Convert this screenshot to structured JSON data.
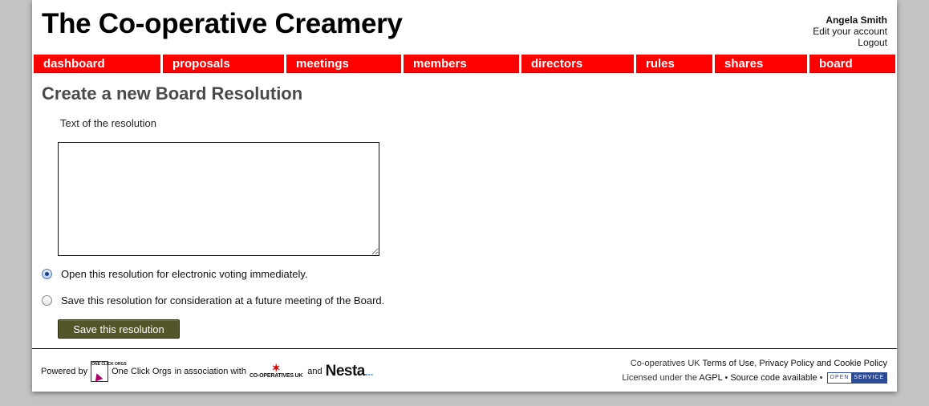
{
  "site": {
    "title": "The Co-operative Creamery"
  },
  "account": {
    "user_name": "Angela Smith",
    "edit_link": "Edit your account",
    "logout_link": "Logout"
  },
  "nav": {
    "items": [
      {
        "label": "dashboard"
      },
      {
        "label": "proposals"
      },
      {
        "label": "meetings"
      },
      {
        "label": "members"
      },
      {
        "label": "directors"
      },
      {
        "label": "rules"
      },
      {
        "label": "shares"
      },
      {
        "label": "board"
      }
    ]
  },
  "main": {
    "heading": "Create a new Board Resolution",
    "text_label": "Text of the resolution",
    "text_value": "",
    "options": [
      {
        "label": "Open this resolution for electronic voting immediately.",
        "checked": true
      },
      {
        "label": "Save this resolution for consideration at a future meeting of the Board.",
        "checked": false
      }
    ],
    "save_button": "Save this resolution"
  },
  "footer": {
    "powered_by": "Powered by",
    "oco_logo_text": "ONE CLICK ORGS",
    "oco_name": "One Click Orgs",
    "in_association": "in association with",
    "coops_logo_text": "CO-OPERATIVES UK",
    "and": "and",
    "nesta": "Nesta",
    "nesta_dots": "...",
    "coops_prefix": "Co-operatives UK",
    "terms_link": "Terms of Use",
    "privacy_link": "Privacy Policy and Cookie Policy",
    "licensed": "Licensed under the",
    "agpl_link": "AGPL",
    "source_link": "Source code available",
    "open_service_open": "OPEN",
    "open_service_service": "SERVICE"
  },
  "colors": {
    "nav_red": "#ff0000",
    "button_olive": "#55552a",
    "page_bg": "#c3c3c3"
  }
}
